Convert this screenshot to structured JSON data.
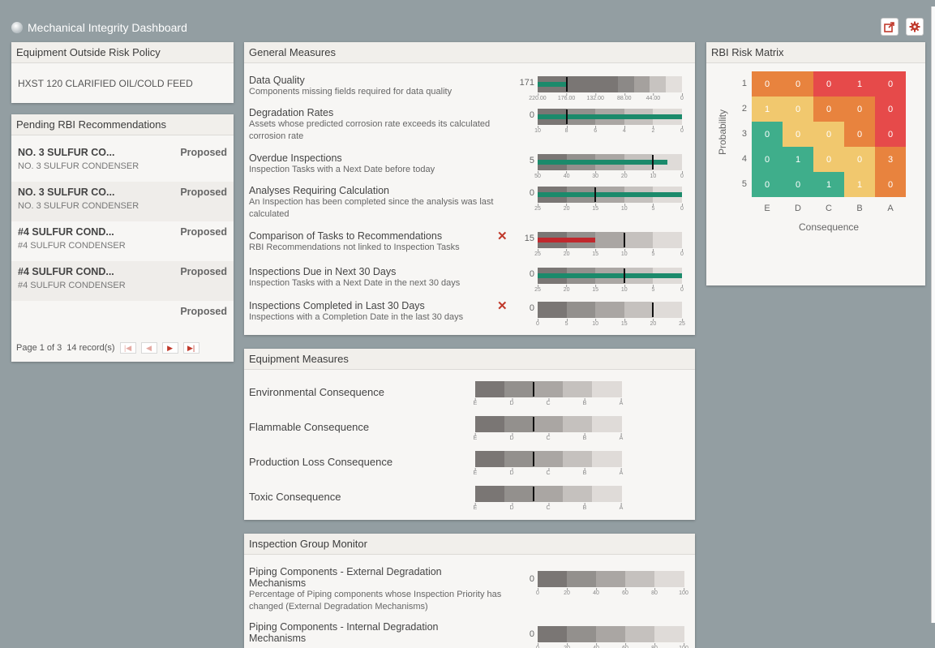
{
  "app": {
    "title": "Mechanical Integrity Dashboard"
  },
  "toolbar": {
    "export_icon": "share-icon",
    "settings_icon": "gear-icon"
  },
  "eorp": {
    "title": "Equipment Outside Risk Policy",
    "items": [
      "HXST 120 CLARIFIED OIL/COLD FEED"
    ]
  },
  "pending": {
    "title": "Pending RBI Recommendations",
    "items": [
      {
        "title": "NO. 3 SULFUR CO...",
        "sub": "NO. 3 SULFUR CONDENSER",
        "status": "Proposed"
      },
      {
        "title": "NO. 3 SULFUR CO...",
        "sub": "NO. 3 SULFUR CONDENSER",
        "status": "Proposed"
      },
      {
        "title": "#4 SULFUR COND...",
        "sub": "#4 SULFUR CONDENSER",
        "status": "Proposed"
      },
      {
        "title": "#4 SULFUR COND...",
        "sub": "#4 SULFUR CONDENSER",
        "status": "Proposed"
      },
      {
        "title": "",
        "sub": "",
        "status": "Proposed"
      }
    ],
    "pager": {
      "page": "Page 1 of 3",
      "records": "14 record(s)"
    }
  },
  "general": {
    "title": "General Measures",
    "rows": [
      {
        "title": "Data Quality",
        "desc": "Components missing fields required for data quality",
        "value": "171",
        "has_x": false,
        "scale": [
          220.0,
          0
        ],
        "ticks": [
          "220.00",
          "176.00",
          "132.00",
          "88.00",
          "44.00",
          "0"
        ],
        "value_num": 171,
        "marker": 176,
        "bar_color": "#1b8a6b",
        "reversed": true
      },
      {
        "title": "Degradation Rates",
        "desc": "Assets whose predicted corrosion rate exceeds its calculated corrosion rate",
        "value": "0",
        "has_x": false,
        "scale": [
          10,
          0
        ],
        "ticks": [
          "10",
          "8",
          "6",
          "4",
          "2",
          "0"
        ],
        "value_num": 0,
        "marker": 8,
        "bar_color": "#1b8a6b",
        "reversed": true
      },
      {
        "title": "Overdue Inspections",
        "desc": "Inspection Tasks with a Next Date before today",
        "value": "5",
        "has_x": false,
        "scale": [
          50,
          0
        ],
        "ticks": [
          "50",
          "40",
          "30",
          "20",
          "10",
          "0"
        ],
        "value_num": 5,
        "marker": 10,
        "bar_color": "#1b8a6b",
        "reversed": true
      },
      {
        "title": "Analyses Requiring Calculation",
        "desc": "An Inspection has been completed since the analysis was last calculated",
        "value": "0",
        "has_x": false,
        "scale": [
          25,
          0
        ],
        "ticks": [
          "25",
          "20",
          "15",
          "10",
          "5",
          "0"
        ],
        "value_num": 0,
        "marker": 15,
        "bar_color": "#1b8a6b",
        "reversed": true
      },
      {
        "title": "Comparison of Tasks to Recommendations",
        "desc": "RBI Recommendations not linked to Inspection Tasks",
        "value": "15",
        "has_x": true,
        "scale": [
          25,
          0
        ],
        "ticks": [
          "25",
          "20",
          "15",
          "10",
          "5",
          "0"
        ],
        "value_num": 15,
        "marker": 10,
        "bar_color": "#c0282d",
        "reversed": true
      },
      {
        "title": "Inspections Due in Next 30 Days",
        "desc": "Inspection Tasks with a Next Date in the next 30 days",
        "value": "0",
        "has_x": false,
        "scale": [
          25,
          0
        ],
        "ticks": [
          "25",
          "20",
          "15",
          "10",
          "5",
          "0"
        ],
        "value_num": 0,
        "marker": 10,
        "bar_color": "#1b8a6b",
        "reversed": true
      },
      {
        "title": "Inspections Completed in Last 30 Days",
        "desc": "Inspections with a Completion Date in the last 30 days",
        "value": "0",
        "has_x": true,
        "scale": [
          0,
          25
        ],
        "ticks": [
          "0",
          "5",
          "10",
          "15",
          "20",
          "25"
        ],
        "value_num": 0,
        "marker": 20,
        "bar_color": "#1b8a6b",
        "reversed": false
      }
    ]
  },
  "equipment": {
    "title": "Equipment Measures",
    "ticks": [
      "E",
      "D",
      "C",
      "B",
      "A"
    ],
    "rows": [
      {
        "label": "Environmental Consequence",
        "marker": "C"
      },
      {
        "label": "Flammable Consequence",
        "marker": "C"
      },
      {
        "label": "Production Loss Consequence",
        "marker": "C"
      },
      {
        "label": "Toxic Consequence",
        "marker": "C"
      }
    ]
  },
  "igm": {
    "title": "Inspection Group Monitor",
    "ticks": [
      "0",
      "20",
      "40",
      "60",
      "80",
      "100"
    ],
    "rows": [
      {
        "title": "Piping Components - External Degradation Mechanisms",
        "desc": "Percentage of Piping components whose Inspection Priority has changed (External Degradation Mechanisms)",
        "value": "0"
      },
      {
        "title": "Piping Components - Internal Degradation Mechanisms",
        "desc": "",
        "value": "0"
      }
    ]
  },
  "matrix": {
    "title": "RBI Risk Matrix",
    "ylabel": "Probability",
    "xlabel": "Consequence",
    "rows": [
      "1",
      "2",
      "3",
      "4",
      "5"
    ],
    "cols": [
      "E",
      "D",
      "C",
      "B",
      "A"
    ],
    "values": [
      [
        "0",
        "0",
        "0",
        "1",
        "0"
      ],
      [
        "1",
        "0",
        "0",
        "0",
        "0"
      ],
      [
        "0",
        "0",
        "0",
        "0",
        "0"
      ],
      [
        "0",
        "1",
        "0",
        "0",
        "3"
      ],
      [
        "0",
        "0",
        "1",
        "1",
        "0"
      ]
    ],
    "colors": [
      [
        "#e8833e",
        "#e8833e",
        "#e64a4a",
        "#e64a4a",
        "#e64a4a"
      ],
      [
        "#f1c86e",
        "#f1c86e",
        "#e8833e",
        "#e8833e",
        "#e64a4a"
      ],
      [
        "#3fae8b",
        "#f1c86e",
        "#f1c86e",
        "#e8833e",
        "#e64a4a"
      ],
      [
        "#3fae8b",
        "#3fae8b",
        "#f1c86e",
        "#f1c86e",
        "#e8833e"
      ],
      [
        "#3fae8b",
        "#3fae8b",
        "#3fae8b",
        "#f1c86e",
        "#e8833e"
      ]
    ]
  }
}
